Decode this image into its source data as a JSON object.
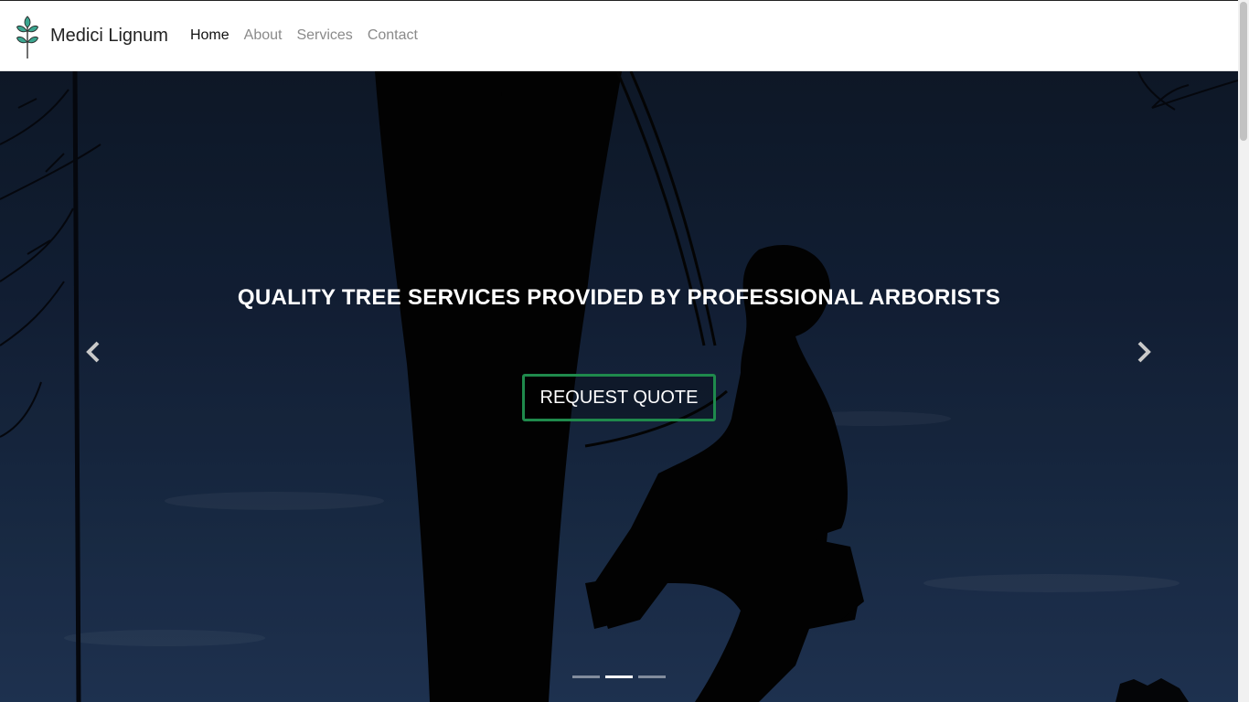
{
  "brand": {
    "name": "Medici Lignum",
    "logo_icon": "sprout-icon",
    "logo_color": "#3ba58f"
  },
  "nav": {
    "items": [
      {
        "label": "Home",
        "active": true
      },
      {
        "label": "About",
        "active": false
      },
      {
        "label": "Services",
        "active": false
      },
      {
        "label": "Contact",
        "active": false
      }
    ]
  },
  "hero": {
    "headline": "QUALITY TREE SERVICES PROVIDED BY PROFESSIONAL ARBORISTS",
    "cta_label": "REQUEST QUOTE",
    "cta_border_color": "#1f8a4c",
    "prev_icon": "chevron-left-icon",
    "next_icon": "chevron-right-icon",
    "slide_count": 3,
    "active_slide": 2
  }
}
